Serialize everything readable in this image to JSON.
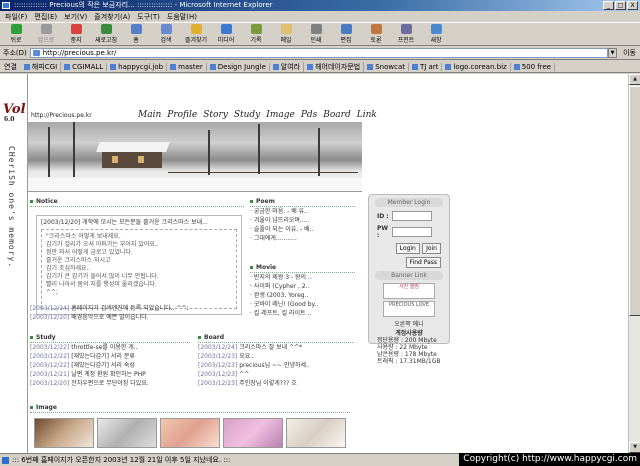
{
  "window": {
    "title": ":::::::::::::: Precious의 작은 보금자리... ::::::::::::::: - Microsoft Internet Explorer",
    "buttons": [
      "_",
      "□",
      "X"
    ]
  },
  "menu": [
    "파일(F)",
    "편집(E)",
    "보기(V)",
    "즐겨찾기(A)",
    "도구(T)",
    "도움말(H)"
  ],
  "toolbar": [
    {
      "label": "뒤로",
      "icon": "back-icon",
      "color": "#2f9e3a",
      "enabled": true
    },
    {
      "label": "앞으로",
      "icon": "forward-icon",
      "color": "#9a9a9a",
      "enabled": false
    },
    {
      "label": "중지",
      "icon": "stop-icon",
      "color": "#d94040",
      "enabled": true
    },
    {
      "label": "새로고침",
      "icon": "refresh-icon",
      "color": "#3b8b3b",
      "enabled": true
    },
    {
      "label": "홈",
      "icon": "home-icon",
      "color": "#5580c8",
      "enabled": true
    },
    {
      "label": "검색",
      "icon": "search-icon",
      "color": "#6a8ad0",
      "enabled": true
    },
    {
      "label": "즐겨찾기",
      "icon": "favorites-icon",
      "color": "#e0b030",
      "enabled": true
    },
    {
      "label": "미디어",
      "icon": "media-icon",
      "color": "#3c7ad0",
      "enabled": true
    },
    {
      "label": "기록",
      "icon": "history-icon",
      "color": "#7a9a40",
      "enabled": true
    },
    {
      "label": "메일",
      "icon": "mail-icon",
      "color": "#e0c070",
      "enabled": true
    },
    {
      "label": "인쇄",
      "icon": "print-icon",
      "color": "#808080",
      "enabled": true
    },
    {
      "label": "편집",
      "icon": "edit-icon",
      "color": "#4a7ac0",
      "enabled": true
    },
    {
      "label": "토론",
      "icon": "discuss-icon",
      "color": "#c07840",
      "enabled": true
    },
    {
      "label": "프린트",
      "icon": "printer-icon",
      "color": "#6d6d9d",
      "enabled": true
    },
    {
      "label": "새창",
      "icon": "new-window-icon",
      "color": "#4a8ad0",
      "enabled": true
    }
  ],
  "address": {
    "label": "주소(D)",
    "value": "http://precious.pe.kr/",
    "go": "이동"
  },
  "links": {
    "label": "연결",
    "items": [
      "해피CGI",
      "CGIMALL",
      "happycgi.job",
      "master",
      "Design Jungle",
      "알여라",
      "헤어데이자문법",
      "Snowcat",
      "TJ art",
      "logo.corean.biz",
      "500 free"
    ]
  },
  "site": {
    "logo": "Vol",
    "logo_version": "6.0",
    "tagline": "CHeriSh one's memory.",
    "url": "http://Precious.pe.kr",
    "nav": [
      "Main",
      "Profile",
      "Story",
      "Study",
      "Image",
      "Pds",
      "Board",
      "Link"
    ]
  },
  "notice": {
    "title": "Notice",
    "headline": "[2003/12/20] 개학에 모시는 모든분들 즐거운 크리스마스 보내...",
    "body": [
      "\"크리스마스 어떻게 보내세요.",
      "감기가 걸리가 오셔 아퍼가는 부어지 있어요..",
      "정만 와서 어떻게 금로고 있었니다.",
      "즐거운 크리스마스 되시고",
      "감기 조심하세요..",
      "감기가 큰 감기가 들어서 많이 너무 안됩니다.",
      "빨리 나아서 몸의 지를 행성미 울리겠습니다.",
      "^^;"
    ],
    "rows": [
      {
        "date": "[2003/12/24]",
        "text": "홈페이지가 검색엔진에 등록 되었습니다.. ^^;"
      },
      {
        "date": "[2003/12/20]",
        "text": "배경음악으로 예쁜 말이습니다."
      }
    ]
  },
  "poem": {
    "title": "Poem",
    "rows": [
      "궁금한 마음. - 배 유..",
      "겨울이 넘뜨리오며.....",
      "슬플이 되는 이유. - 배..",
      "그대에게..........."
    ]
  },
  "movie": {
    "title": "Movie",
    "rows": [
      "반지의 제왕 3 - 왕의 ..",
      "사이퍼 (Cypher , 2..",
      "완생 (2003, Yoreg..",
      "굿바이 레닌! (Good by..",
      "킬 레프트, 킬 라이트 .."
    ]
  },
  "study": {
    "title": "Study",
    "rows": [
      {
        "date": "[2003/12/22]",
        "text": "throttle-se를 이용한 개.."
      },
      {
        "date": "[2003/12/22]",
        "text": "[재밌는다감기] 서리 분류"
      },
      {
        "date": "[2003/12/22]",
        "text": "[재밌는다감기] 서리 숙성"
      },
      {
        "date": "[2003/12/21]",
        "text": "날편 계정 환원 확인하는 PHP"
      },
      {
        "date": "[2003/12/20]",
        "text": "잔치우편으로 무단이징 다있요."
      }
    ]
  },
  "board": {
    "title": "Board",
    "rows": [
      {
        "date": "[2003/12/24]",
        "text": "크리스마스 잘 보내 ^^*"
      },
      {
        "date": "[2003/12/23]",
        "text": "요요.."
      },
      {
        "date": "[2003/12/23]",
        "text": "precious님 ~~ 안녕하세.."
      },
      {
        "date": "[2003/12/23]",
        "text": "^^"
      },
      {
        "date": "[2003/12/23]",
        "text": "주인장님 이렇게??? 흐"
      }
    ]
  },
  "image": {
    "title": "Image"
  },
  "login": {
    "title": "Member Login",
    "id_label": "ID :",
    "pw_label": "PW :",
    "login_btn": "Login",
    "join_btn": "Join",
    "find_btn": "Find Pass",
    "banner_title": "Banner Link",
    "banner1": "사진 앨범",
    "banner2": "PRECIOUS LOVE",
    "banner_caption": "오른쪽 메니",
    "stats_title": "계정사용량",
    "stats": [
      "정단용량 : 200 Mbyte",
      "사용량 : 22 Mbyte",
      "남은용량 : 178 Mbyte",
      "트래픽 : 17.31MB/1GB"
    ]
  },
  "status": "::: 6번째 홈페이지가 오픈한지 2003년 12월 21일 이후 5일 지났네요. :::",
  "copyright": "Copyright(c) http://www.happycgi.com"
}
